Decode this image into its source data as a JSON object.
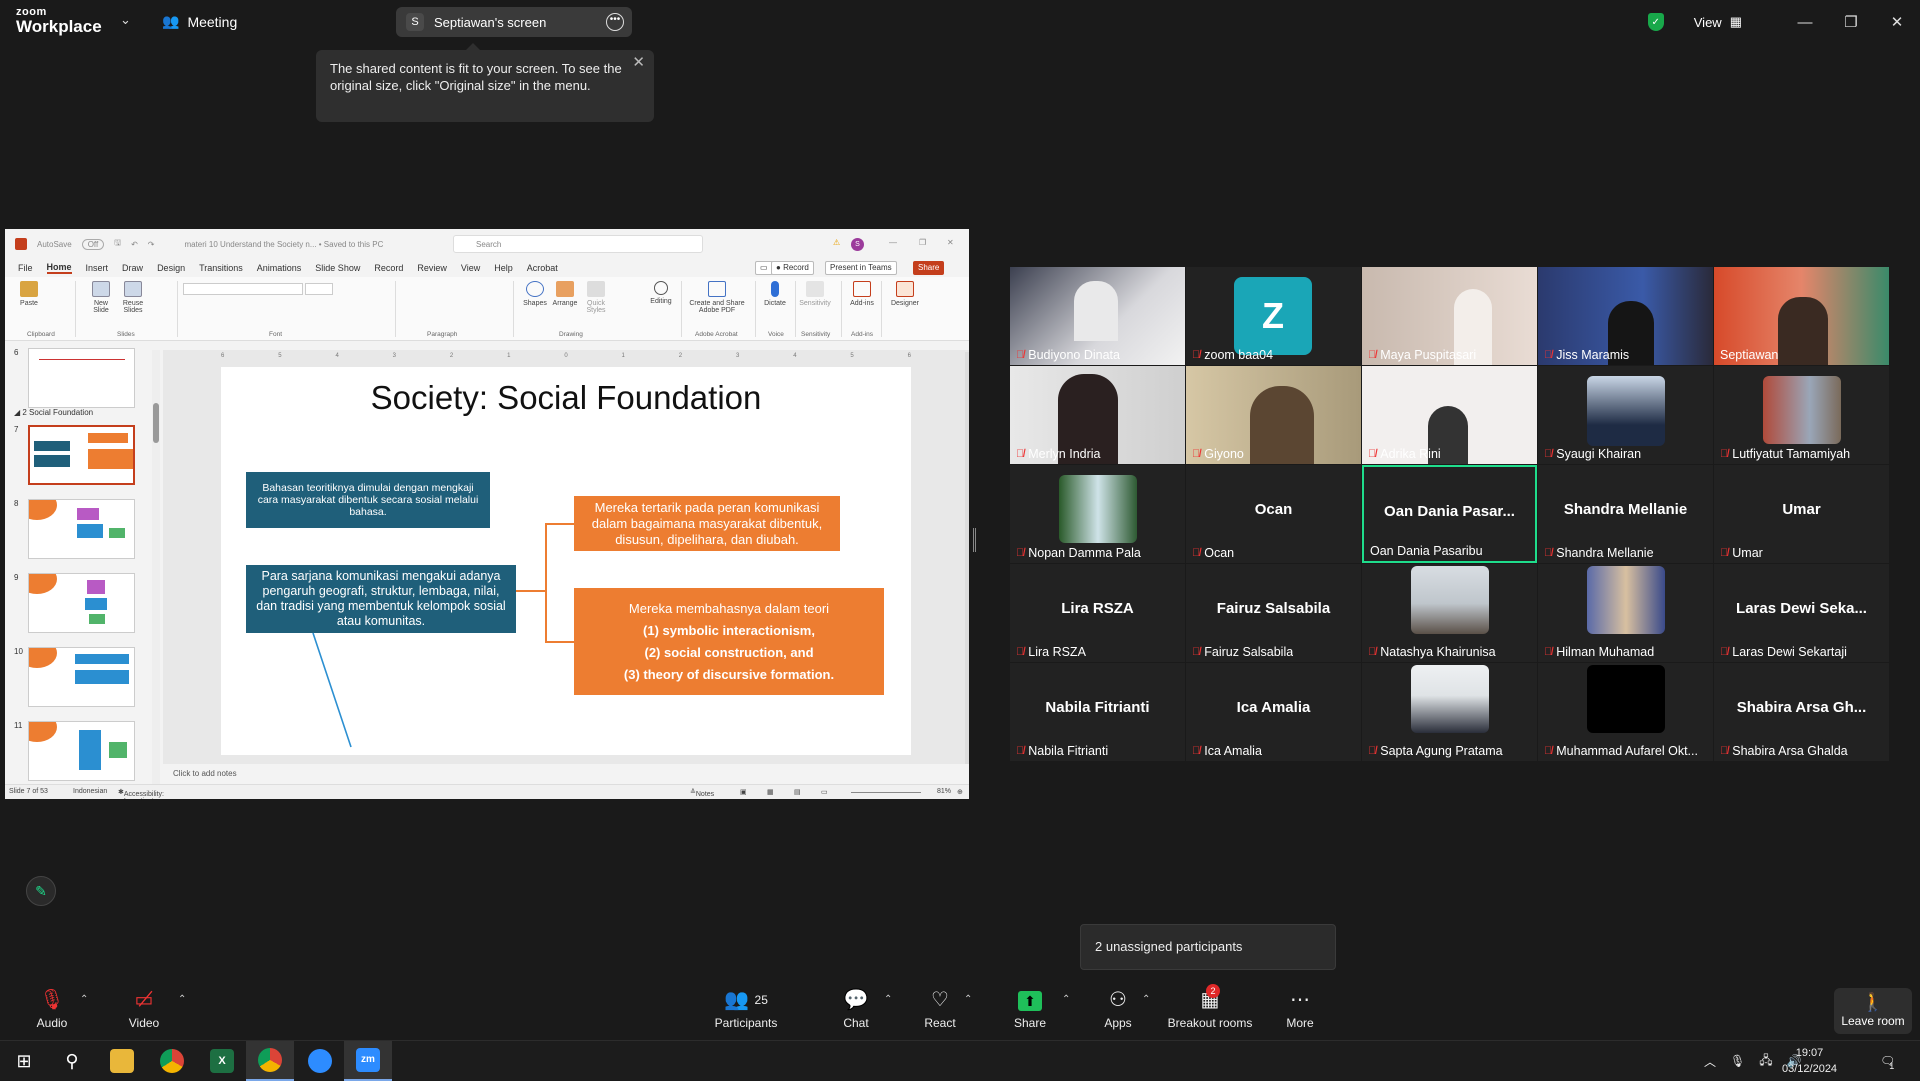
{
  "app": {
    "brand_line1": "zoom",
    "brand_line2": "Workplace",
    "meeting_label": "Meeting",
    "screen_owner_initial": "S",
    "screen_label": "Septiawan's screen",
    "view_label": "View"
  },
  "tooltip": {
    "text": "The shared content is fit to your screen. To see the original size, click \"Original size\" in the menu."
  },
  "ppt": {
    "autosave": "AutoSave",
    "autosave_state": "Off",
    "doc_title": "materi 10 Understand the Society n... • Saved to this PC",
    "search_placeholder": "Search",
    "user_initial": "S",
    "tabs": [
      "File",
      "Home",
      "Insert",
      "Draw",
      "Design",
      "Transitions",
      "Animations",
      "Slide Show",
      "Record",
      "Review",
      "View",
      "Help",
      "Acrobat"
    ],
    "record_btn": "Record",
    "present_btn": "Present in Teams",
    "share_btn": "Share",
    "ribbon": {
      "paste": "Paste",
      "new_slide": "New Slide",
      "reuse_slides": "Reuse Slides",
      "shapes": "Shapes",
      "arrange": "Arrange",
      "quick_styles": "Quick Styles",
      "editing": "Editing",
      "create_share_pdf": "Create and Share Adobe PDF",
      "dictate": "Dictate",
      "sensitivity": "Sensitivity",
      "add_ins": "Add-ins",
      "designer": "Designer",
      "groups": [
        "Clipboard",
        "Slides",
        "Font",
        "Paragraph",
        "Drawing",
        "Adobe Acrobat",
        "Voice",
        "Sensitivity",
        "Add-ins"
      ]
    },
    "section_label": "2 Social Foundation",
    "thumb_numbers": [
      "6",
      "7",
      "8",
      "9",
      "10",
      "11"
    ],
    "slide": {
      "title": "Society: Social Foundation",
      "box1": "Bahasan teoritiknya dimulai dengan mengkaji cara masyarakat dibentuk secara sosial melalui bahasa.",
      "box2": "Para sarjana komunikasi mengakui adanya pengaruh geografi, struktur, lembaga, nilai, dan tradisi yang membentuk kelompok sosial atau komunitas.",
      "box3": "Mereka tertarik pada peran komunikasi dalam bagaimana masyarakat dibentuk, disusun, dipelihara, dan diubah.",
      "box4_intro": "Mereka membahasnya dalam teori",
      "box4_l1": "(1) symbolic interactionism,",
      "box4_l2": "(2) social construction, and",
      "box4_l3": "(3) theory of discursive formation."
    },
    "ruler_ticks": [
      "6",
      "5",
      "4",
      "3",
      "2",
      "1",
      "0",
      "1",
      "2",
      "3",
      "4",
      "5",
      "6"
    ],
    "notes_placeholder": "Click to add notes",
    "status": {
      "slide_of": "Slide 7 of 53",
      "language": "Indonesian",
      "accessibility": "Accessibility: Investigate",
      "notes": "Notes",
      "zoom": "81%"
    }
  },
  "gallery": {
    "tiles": [
      {
        "name": "Budiyono Dinata",
        "video": true
      },
      {
        "name": "zoom baa04",
        "avatar": "Z"
      },
      {
        "name": "Maya Puspitasari",
        "video": true
      },
      {
        "name": "Jiss  Maramis",
        "video": true
      },
      {
        "name": "Septiawan",
        "video": true
      },
      {
        "name": "Merlyn Indria",
        "video": true
      },
      {
        "name": "Giyono",
        "video": true
      },
      {
        "name": "Adrika Rini",
        "video": true
      },
      {
        "name": "Syaugi Khairan",
        "video": true
      },
      {
        "name": "Lutfiyatut Tamamiyah",
        "video": true
      },
      {
        "name": "Nopan Damma Pala",
        "video": true
      },
      {
        "name": "Ocan",
        "big": "Ocan"
      },
      {
        "name": "Oan Dania Pasaribu",
        "big": "Oan  Dania  Pasar...",
        "active": true
      },
      {
        "name": "Shandra Mellanie",
        "big": "Shandra Mellanie"
      },
      {
        "name": "Umar",
        "big": "Umar"
      },
      {
        "name": "Lira RSZA",
        "big": "Lira RSZA"
      },
      {
        "name": "Fairuz Salsabila",
        "big": "Fairuz Salsabila"
      },
      {
        "name": "Natashya Khairunisa",
        "video": true
      },
      {
        "name": "Hilman Muhamad",
        "video": true
      },
      {
        "name": "Laras Dewi Sekartaji",
        "big": "Laras  Dewi  Seka..."
      },
      {
        "name": "Nabila Fitrianti",
        "big": "Nabila Fitrianti"
      },
      {
        "name": "Ica Amalia",
        "big": "Ica Amalia"
      },
      {
        "name": "Sapta Agung Pratama",
        "video": true
      },
      {
        "name": "Muhammad Aufarel Okt...",
        "video": true
      },
      {
        "name": "Shabira Arsa Ghalda",
        "big": "Shabira  Arsa  Gh..."
      }
    ]
  },
  "unassigned": "2 unassigned participants",
  "toolbar": {
    "audio": "Audio",
    "video": "Video",
    "participants": "Participants",
    "participants_count": "25",
    "chat": "Chat",
    "react": "React",
    "share": "Share",
    "apps": "Apps",
    "breakout": "Breakout rooms",
    "breakout_badge": "2",
    "more": "More",
    "leave": "Leave room"
  },
  "taskbar": {
    "time": "19:07",
    "date": "03/12/2024",
    "notif_count": "1"
  }
}
